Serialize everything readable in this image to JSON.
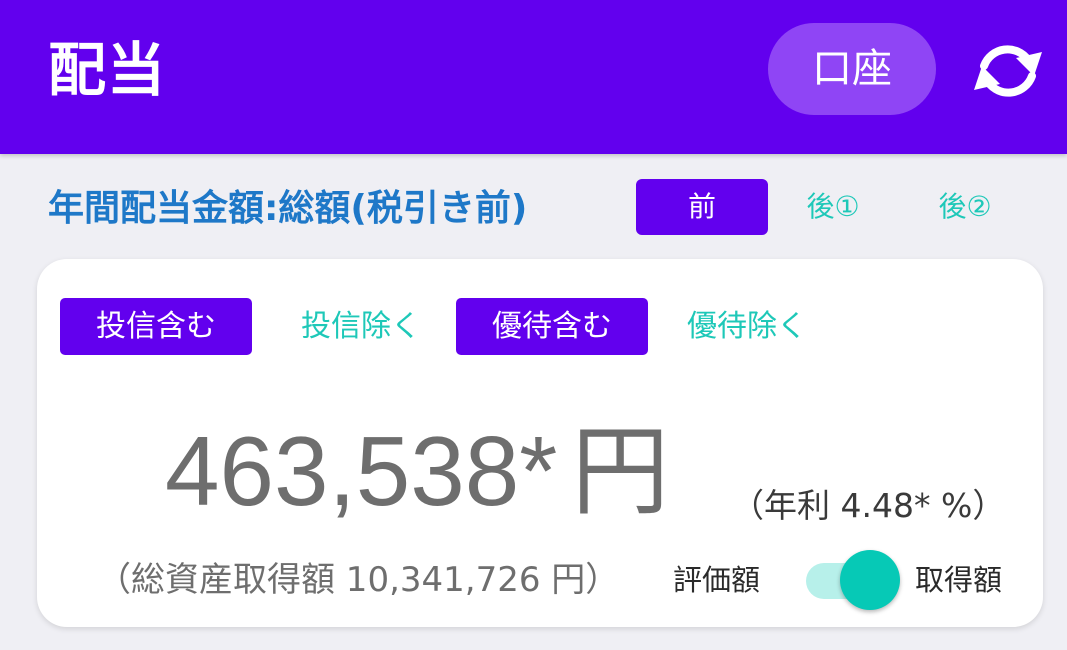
{
  "app_bar": {
    "title": "配当",
    "account_button_label": "口座",
    "refresh_icon": "refresh-icon"
  },
  "section": {
    "title": "年間配当金額:総額(税引き前)"
  },
  "tax_tabs": [
    {
      "label": "前",
      "active": true
    },
    {
      "label": "後①",
      "active": false
    },
    {
      "label": "後②",
      "active": false
    }
  ],
  "filters": [
    {
      "label": "投信含む",
      "active": true
    },
    {
      "label": "投信除く",
      "active": false
    },
    {
      "label": "優待含む",
      "active": true
    },
    {
      "label": "優待除く",
      "active": false
    }
  ],
  "summary": {
    "amount": "463,538*",
    "currency": "円",
    "yield_text": "（年利 4.48* %）",
    "total_assets_text": "（総資産取得額 10,341,726 円）"
  },
  "toggle": {
    "left_label": "評価額",
    "right_label": "取得額",
    "selected": "取得額"
  },
  "colors": {
    "primary": "#6200ee",
    "accent": "#1ec8b8",
    "title_blue": "#1e78c8"
  }
}
